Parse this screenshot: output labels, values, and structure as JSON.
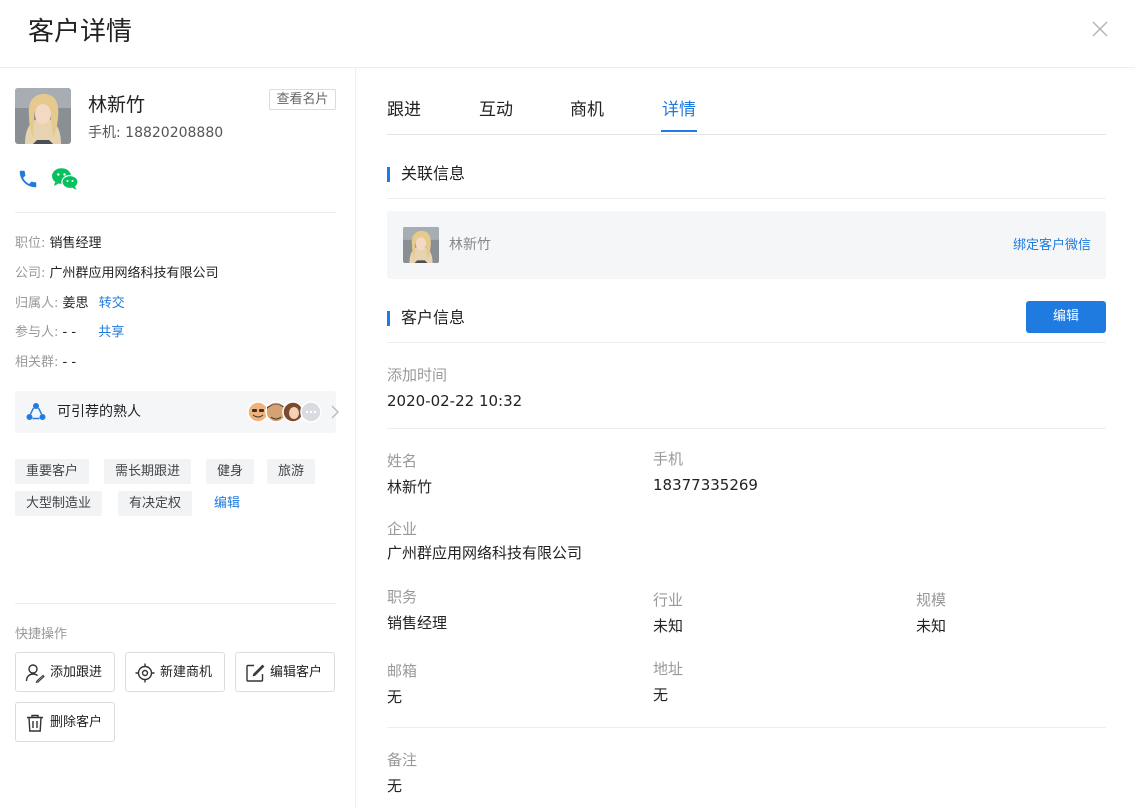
{
  "header": {
    "title": "客户详情"
  },
  "profile": {
    "name": "林新竹",
    "phone_label": "手机:",
    "phone": "18820208880",
    "view_card": "查看名片"
  },
  "info": {
    "position_label": "职位:",
    "position": "销售经理",
    "company_label": "公司:",
    "company": "广州群应用网络科技有限公司",
    "owner_label": "归属人:",
    "owner": "姜思",
    "owner_action": "转交",
    "participant_label": "参与人:",
    "participant": "- -",
    "participant_action": "共享",
    "group_label": "相关群:",
    "group": "- -"
  },
  "referral": {
    "label": "可引荐的熟人"
  },
  "tags": [
    "重要客户",
    "需长期跟进",
    "健身",
    "旅游",
    "大型制造业",
    "有决定权"
  ],
  "tag_edit": "编辑",
  "quick_actions": {
    "title": "快捷操作",
    "add_followup": "添加跟进",
    "new_opportunity": "新建商机",
    "edit_customer": "编辑客户",
    "delete_customer": "删除客户"
  },
  "tabs": [
    "跟进",
    "互动",
    "商机",
    "详情"
  ],
  "related": {
    "title": "关联信息",
    "name": "林新竹",
    "bind_wechat": "绑定客户微信"
  },
  "customer": {
    "title": "客户信息",
    "edit": "编辑",
    "add_time_label": "添加时间",
    "add_time": "2020-02-22 10:32",
    "name_label": "姓名",
    "name": "林新竹",
    "mobile_label": "手机",
    "mobile": "18377335269",
    "company_label": "企业",
    "company": "广州群应用网络科技有限公司",
    "job_label": "职务",
    "job": "销售经理",
    "industry_label": "行业",
    "industry": "未知",
    "scale_label": "规模",
    "scale": "未知",
    "email_label": "邮箱",
    "email": "无",
    "address_label": "地址",
    "address": "无",
    "note_label": "备注",
    "note": "无"
  },
  "colors": {
    "accent": "#1f7be0",
    "wechat": "#07c160"
  }
}
